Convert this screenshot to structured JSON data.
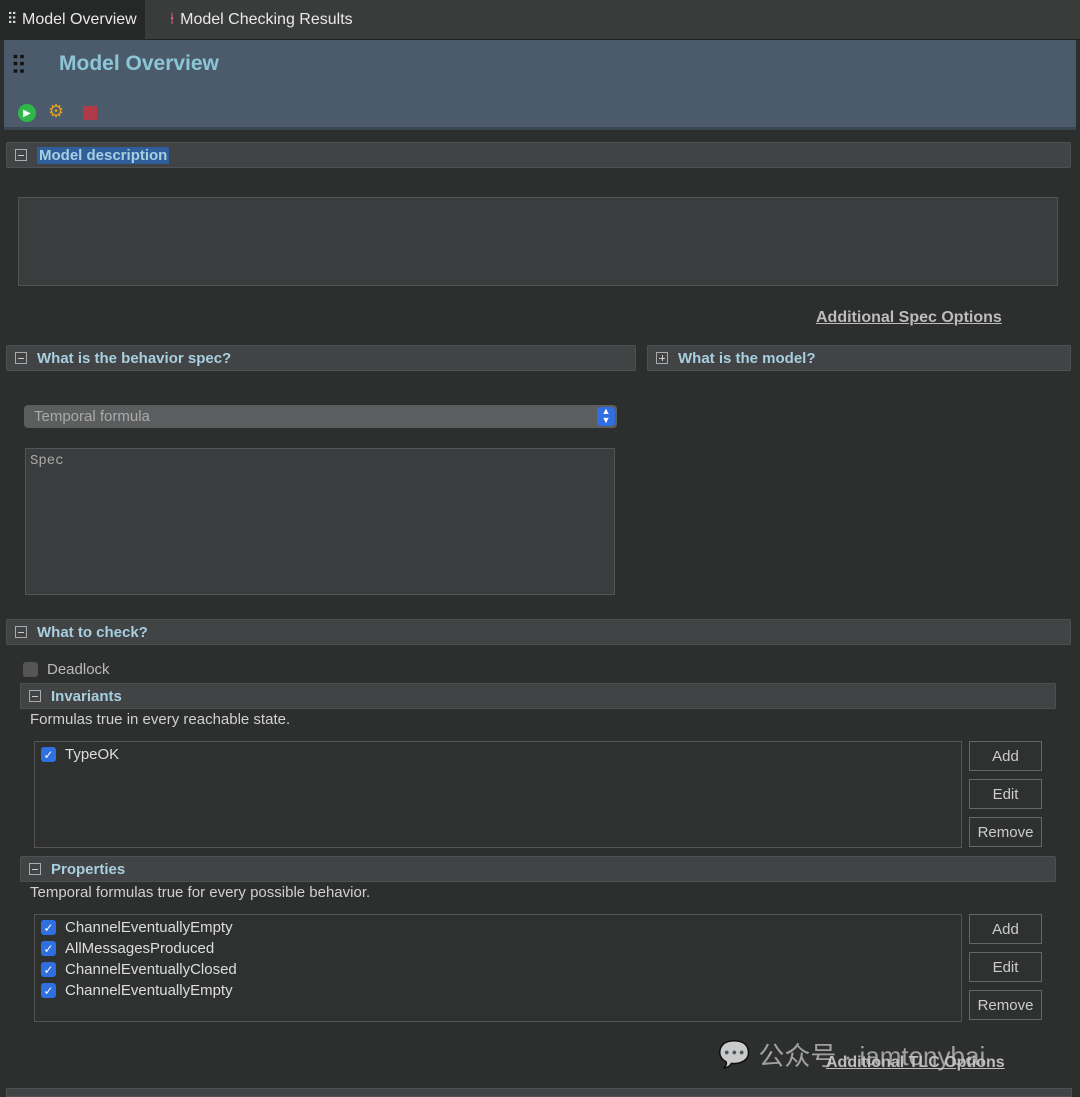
{
  "tabs": [
    {
      "label": "Model Overview",
      "icon": "sliders-icon"
    },
    {
      "label": "Model Checking Results",
      "icon": "pin-icon"
    }
  ],
  "header": {
    "title": "Model Overview",
    "toolbar": [
      {
        "icon": "run-icon",
        "color": "#2eb84a"
      },
      {
        "icon": "gears-icon",
        "color": "#e0a020"
      },
      {
        "icon": "stop-icon",
        "color": "#b03a48"
      }
    ]
  },
  "model_description": {
    "label": "Model description",
    "value": ""
  },
  "additional_spec_options": "Additional Spec Options",
  "behavior": {
    "label": "What is the behavior spec?",
    "select_value": "Temporal formula",
    "spec_value": "Spec"
  },
  "model": {
    "label": "What is the model?"
  },
  "check": {
    "label": "What to check?",
    "deadlock": "Deadlock",
    "invariants": {
      "label": "Invariants",
      "description": "Formulas true in every reachable state.",
      "items": [
        "TypeOK"
      ]
    },
    "properties": {
      "label": "Properties",
      "description": "Temporal formulas true for every possible behavior.",
      "items": [
        "ChannelEventuallyEmpty",
        "AllMessagesProduced",
        "ChannelEventuallyClosed",
        "ChannelEventuallyEmpty"
      ]
    },
    "buttons": {
      "add": "Add",
      "edit": "Edit",
      "remove": "Remove"
    }
  },
  "additional_tlc_options": "Additional TLC Options",
  "watermark": "公众号 · iamtonybai"
}
